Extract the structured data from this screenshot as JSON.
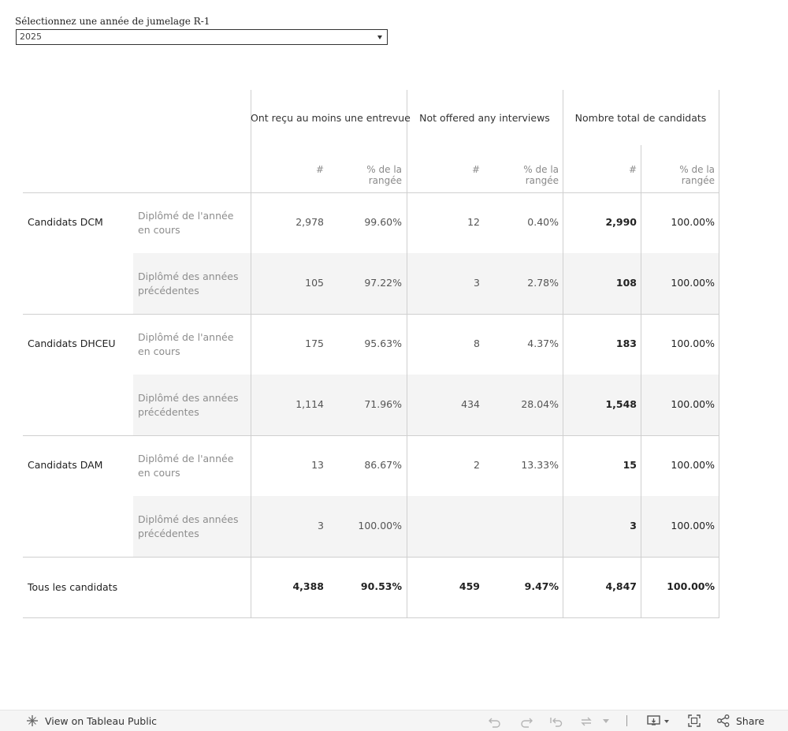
{
  "filter": {
    "label": "Sélectionnez une année de jumelage R-1",
    "selected": "2025"
  },
  "table": {
    "groups": [
      {
        "label": "Ont reçu au moins une entrevue"
      },
      {
        "label": "Not offered any interviews"
      },
      {
        "label": "Nombre total de candidats"
      }
    ],
    "subheaders": [
      "#",
      "% de la rangée",
      "#",
      "% de la rangée",
      "#",
      "% de la rangée"
    ],
    "rows": [
      {
        "group": "Candidats DCM",
        "sub": "Diplômé de l'année en cours",
        "values": [
          "2,978",
          "99.60%",
          "12",
          "0.40%",
          "2,990",
          "100.00%"
        ]
      },
      {
        "group": "",
        "sub": "Diplômé des années précédentes",
        "values": [
          "105",
          "97.22%",
          "3",
          "2.78%",
          "108",
          "100.00%"
        ]
      },
      {
        "group": "Candidats DHCEU",
        "sub": "Diplômé de l'année en cours",
        "values": [
          "175",
          "95.63%",
          "8",
          "4.37%",
          "183",
          "100.00%"
        ]
      },
      {
        "group": "",
        "sub": "Diplômé des années précédentes",
        "values": [
          "1,114",
          "71.96%",
          "434",
          "28.04%",
          "1,548",
          "100.00%"
        ]
      },
      {
        "group": "Candidats DAM",
        "sub": "Diplômé de l'année en cours",
        "values": [
          "13",
          "86.67%",
          "2",
          "13.33%",
          "15",
          "100.00%"
        ]
      },
      {
        "group": "",
        "sub": "Diplômé des années précédentes",
        "values": [
          "3",
          "100.00%",
          "",
          "",
          "3",
          "100.00%"
        ]
      }
    ],
    "total": {
      "label": "Tous les candidats",
      "values": [
        "4,388",
        "90.53%",
        "459",
        "9.47%",
        "4,847",
        "100.00%"
      ]
    }
  },
  "footer": {
    "view_label": "View on Tableau Public",
    "share_label": "Share"
  },
  "icons": {
    "tableau": "tableau-logo-icon",
    "undo": "undo-icon",
    "redo": "redo-icon",
    "revert": "revert-icon",
    "refresh": "refresh-icon",
    "download": "download-icon",
    "fullscreen": "fullscreen-icon",
    "share": "share-icon"
  }
}
